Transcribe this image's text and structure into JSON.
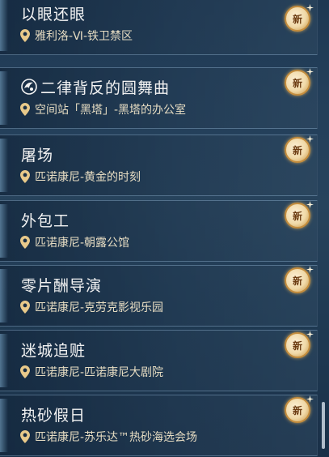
{
  "quests": [
    {
      "title": "以眼还眼",
      "location": "雅利洛-Ⅵ-铁卫禁区",
      "badge": "新",
      "type_icon": null
    },
    {
      "title": "二律背反的圆舞曲",
      "location": "空间站「黑塔」-黑塔的办公室",
      "badge": "新",
      "type_icon": "quest-type-icon"
    },
    {
      "title": "屠场",
      "location": "匹诺康尼-黄金的时刻",
      "badge": "新",
      "type_icon": null
    },
    {
      "title": "外包工",
      "location": "匹诺康尼-朝露公馆",
      "badge": "新",
      "type_icon": null
    },
    {
      "title": "零片酬导演",
      "location": "匹诺康尼-克劳克影视乐园",
      "badge": "新",
      "type_icon": null
    },
    {
      "title": "迷城追赃",
      "location": "匹诺康尼-匹诺康尼大剧院",
      "badge": "新",
      "type_icon": null
    },
    {
      "title": "热砂假日",
      "location": "匹诺康尼-苏乐达™热砂海选会场",
      "badge": "新",
      "type_icon": null
    }
  ],
  "colors": {
    "title": "#f2f2f2",
    "location": "#e6dcc2",
    "pin": "#e8c98a",
    "badge_text": "#6d3d12"
  }
}
